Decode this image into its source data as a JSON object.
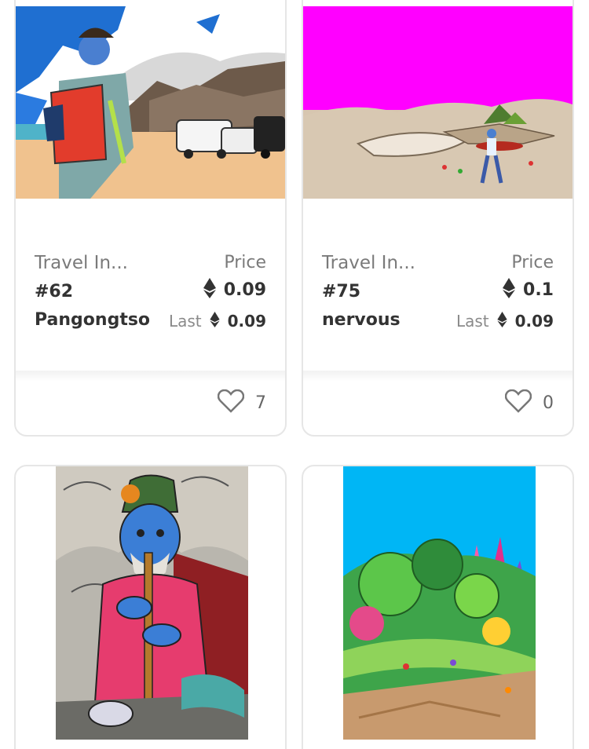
{
  "cards": [
    {
      "collection": "Travel In...",
      "token_id": "#62",
      "token_name": "Pangongtso",
      "price_label": "Price",
      "price": "0.09",
      "last_label": "Last",
      "last_price": "0.09",
      "likes": "7",
      "icons": [
        "ethereum-icon",
        "heart-icon"
      ]
    },
    {
      "collection": "Travel In...",
      "token_id": "#75",
      "token_name": "nervous",
      "price_label": "Price",
      "price": "0.1",
      "last_label": "Last",
      "last_price": "0.09",
      "likes": "0",
      "icons": [
        "ethereum-icon",
        "heart-icon"
      ]
    }
  ],
  "colors": {
    "card_border": "#e6e6e6",
    "muted_text": "#7a7a7a",
    "strong_text": "#333333"
  }
}
